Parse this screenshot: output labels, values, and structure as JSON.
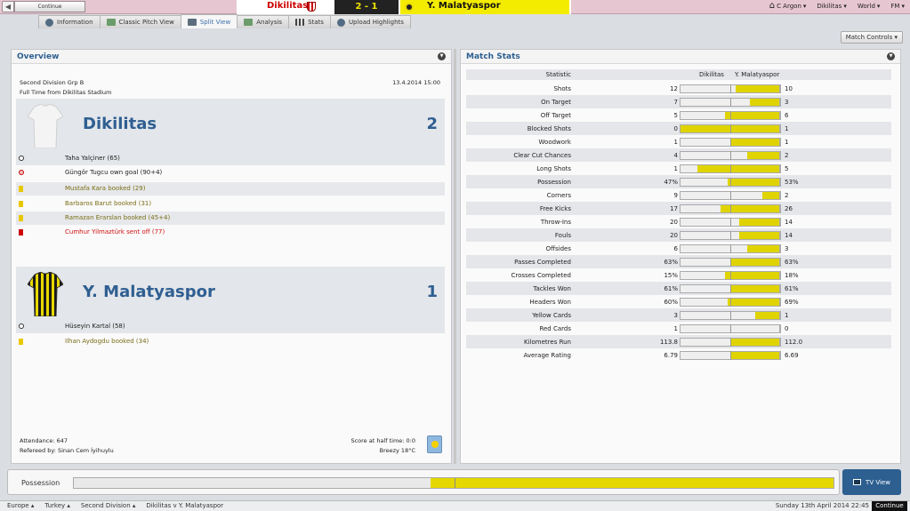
{
  "topbar": {
    "back_icon": "chevron-left-icon",
    "continue_label": "Continue",
    "home_team": "Dikilitas",
    "score": "2 - 1",
    "away_team": "Y. Malatyaspor",
    "nav": [
      "C Argon",
      "Dikilitas",
      "World",
      "FM"
    ],
    "colors": {
      "home": "#cc0000",
      "away_bg": "#f4ec00",
      "score_bg": "#222222",
      "score_fg": "#f2e300"
    }
  },
  "tabs": [
    "Information",
    "Classic Pitch View",
    "Split View",
    "Analysis",
    "Stats",
    "Upload Highlights"
  ],
  "active_tab": "Split View",
  "match_controls_label": "Match Controls",
  "overview": {
    "title": "Overview",
    "competition": "Second Division Grp B",
    "datetime": "13.4.2014 15:00",
    "venue": "Full Time from Dikilitas Stadium",
    "home": {
      "name": "Dikilitas",
      "goals": "2",
      "events": [
        {
          "type": "goal",
          "text": "Taha Yalçiner (65)"
        },
        {
          "type": "own-goal",
          "text": "Güngör Tugcu own goal (90+4)"
        },
        {
          "type": "yellow",
          "text": "Mustafa Kara booked (29)"
        },
        {
          "type": "yellow",
          "text": "Barbaros Barut booked (31)"
        },
        {
          "type": "yellow",
          "text": "Ramazan Erarslan booked (45+4)"
        },
        {
          "type": "red",
          "text": "Cumhur Yilmaztürk sent off (77)"
        }
      ]
    },
    "away": {
      "name": "Y. Malatyaspor",
      "goals": "1",
      "events": [
        {
          "type": "goal",
          "text": "Hüseyin Kartal (58)"
        },
        {
          "type": "yellow",
          "text": "Ilhan Aydogdu booked (34)"
        }
      ]
    },
    "attendance": "Attendance: 647",
    "referee": "Refereed by: Sinan Cem İyihuylu",
    "halftime": "Score at half time: 0:0",
    "weather": "Breezy 18°C"
  },
  "match_stats": {
    "title": "Match Stats",
    "header": {
      "statistic": "Statistic",
      "home": "Dikilitas",
      "away": "Y. Malatyaspor"
    },
    "rows": [
      {
        "label": "Shots",
        "home": "12",
        "away": "10",
        "away_share": 0.45
      },
      {
        "label": "On Target",
        "home": "7",
        "away": "3",
        "away_share": 0.3
      },
      {
        "label": "Off Target",
        "home": "5",
        "away": "6",
        "away_share": 0.55
      },
      {
        "label": "Blocked Shots",
        "home": "0",
        "away": "1",
        "away_share": 1.0
      },
      {
        "label": "Woodwork",
        "home": "1",
        "away": "1",
        "away_share": 0.5
      },
      {
        "label": "Clear Cut Chances",
        "home": "4",
        "away": "2",
        "away_share": 0.33
      },
      {
        "label": "Long Shots",
        "home": "1",
        "away": "5",
        "away_share": 0.83
      },
      {
        "label": "Possession",
        "home": "47%",
        "away": "53%",
        "away_share": 0.53
      },
      {
        "label": "Corners",
        "home": "9",
        "away": "2",
        "away_share": 0.18
      },
      {
        "label": "Free Kicks",
        "home": "17",
        "away": "26",
        "away_share": 0.6
      },
      {
        "label": "Throw-Ins",
        "home": "20",
        "away": "14",
        "away_share": 0.41
      },
      {
        "label": "Fouls",
        "home": "20",
        "away": "14",
        "away_share": 0.41
      },
      {
        "label": "Offsides",
        "home": "6",
        "away": "3",
        "away_share": 0.33
      },
      {
        "label": "Passes Completed",
        "home": "63%",
        "away": "63%",
        "away_share": 0.5
      },
      {
        "label": "Crosses Completed",
        "home": "15%",
        "away": "18%",
        "away_share": 0.55
      },
      {
        "label": "Tackles Won",
        "home": "61%",
        "away": "61%",
        "away_share": 0.5
      },
      {
        "label": "Headers Won",
        "home": "60%",
        "away": "69%",
        "away_share": 0.53
      },
      {
        "label": "Yellow Cards",
        "home": "3",
        "away": "1",
        "away_share": 0.25
      },
      {
        "label": "Red Cards",
        "home": "1",
        "away": "0",
        "away_share": 0.0
      },
      {
        "label": "Kilometres Run",
        "home": "113.8",
        "away": "112.0",
        "away_share": 0.5
      },
      {
        "label": "Average Rating",
        "home": "6.79",
        "away": "6.69",
        "away_share": 0.5
      }
    ]
  },
  "possession_bar": {
    "label": "Possession",
    "away_share": 0.53
  },
  "tv_view_label": "TV View",
  "breadcrumbs": [
    "Europe",
    "Turkey",
    "Second Division",
    "Dikilitas v Y. Malatyaspor"
  ],
  "footer_datetime": "Sunday 13th April 2014 22:45",
  "footer_continue": "Continue"
}
